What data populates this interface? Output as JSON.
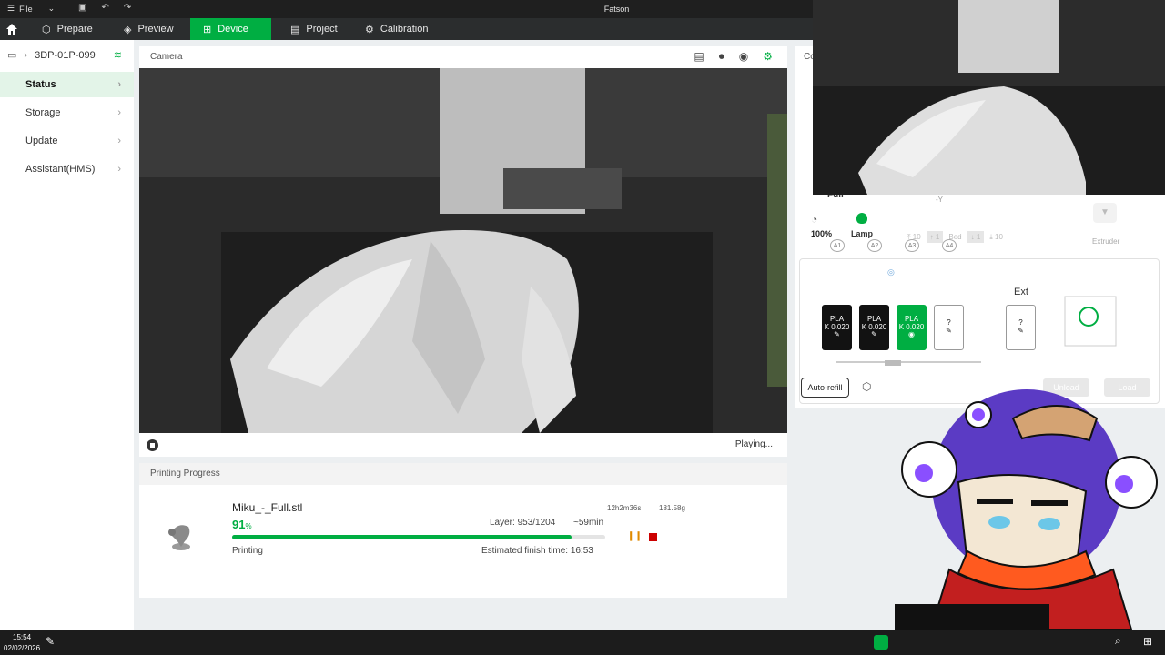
{
  "app": {
    "title": "Fatson",
    "file_menu": "File"
  },
  "nav": {
    "tabs": [
      {
        "label": "Prepare"
      },
      {
        "label": "Preview"
      },
      {
        "label": "Device"
      },
      {
        "label": "Project"
      },
      {
        "label": "Calibration"
      }
    ],
    "active_tab": "Device",
    "accent": "#00ae42"
  },
  "sidebar": {
    "device_name": "3DP-01P-099",
    "items": [
      {
        "label": "Status"
      },
      {
        "label": "Storage"
      },
      {
        "label": "Update"
      },
      {
        "label": "Assistant(HMS)"
      }
    ]
  },
  "camera": {
    "header": "Camera",
    "status": "Playing..."
  },
  "progress": {
    "header": "Printing Progress",
    "filename": "Miku_-_Full.stl",
    "percent_value": "91",
    "percent_unit": "%",
    "progress_fraction": 0.91,
    "layer": "Layer: 953/1204",
    "remaining": "~59min",
    "status": "Printing",
    "finish": "Estimated finish time: 16:53",
    "total_time": "12h2m36s",
    "weight": "181.58g"
  },
  "controls": {
    "header_partial": "Co",
    "speed": "100%",
    "lamp": "Lamp",
    "speed_partial": "Full",
    "axis_hint": "-Y",
    "bed_label": "Bed",
    "bed_steps": [
      "10",
      "1",
      "1",
      "10"
    ],
    "extruder": "Extruder"
  },
  "ams": {
    "slots": [
      {
        "tag": "A1",
        "type": "PLA",
        "k": "K 0.020",
        "style": "dark"
      },
      {
        "tag": "A2",
        "type": "PLA",
        "k": "K 0.020",
        "style": "dark"
      },
      {
        "tag": "A3",
        "type": "PLA",
        "k": "K 0.020",
        "style": "green"
      },
      {
        "tag": "A4",
        "type": "?",
        "k": "",
        "style": "white"
      }
    ],
    "ext_label": "Ext",
    "ext_slot": "?",
    "auto_refill": "Auto-refill",
    "unload": "Unload",
    "load": "Load"
  },
  "taskbar": {
    "time": "15:54",
    "date": "02/02/2026"
  }
}
